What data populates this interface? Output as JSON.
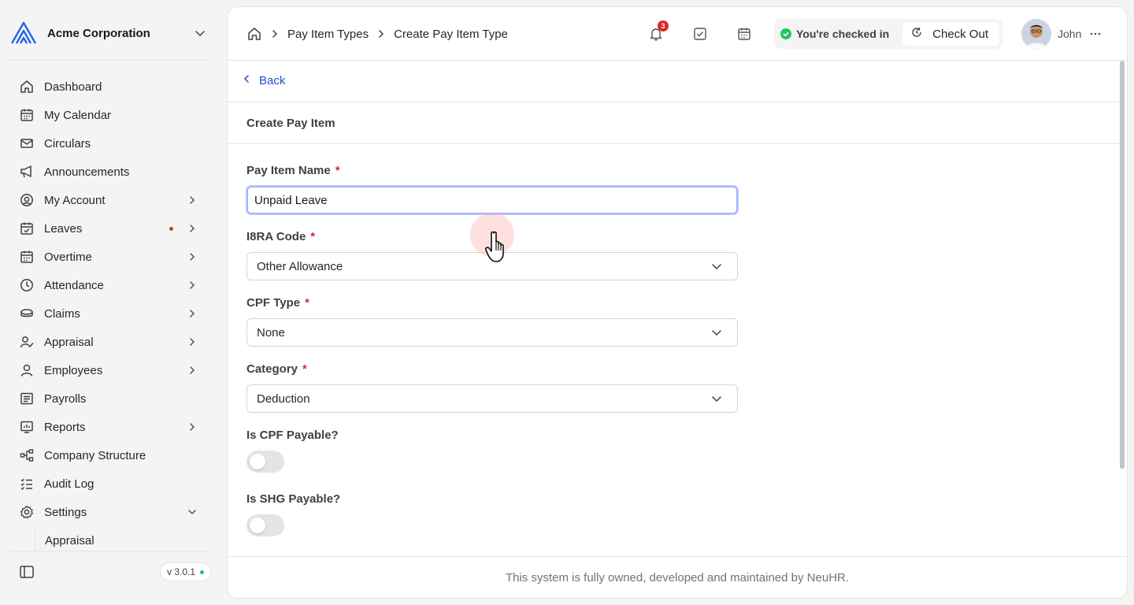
{
  "organization": {
    "name": "Acme Corporation"
  },
  "sidebar": {
    "items": [
      {
        "label": "Dashboard",
        "icon": "home-icon"
      },
      {
        "label": "My Calendar",
        "icon": "calendar-icon"
      },
      {
        "label": "Circulars",
        "icon": "mail-icon"
      },
      {
        "label": "Announcements",
        "icon": "megaphone-icon"
      },
      {
        "label": "My Account",
        "icon": "user-circle-icon"
      },
      {
        "label": "Leaves",
        "icon": "calendar-check-icon"
      },
      {
        "label": "Overtime",
        "icon": "calendar-clock-icon"
      },
      {
        "label": "Attendance",
        "icon": "clock-icon"
      },
      {
        "label": "Claims",
        "icon": "coins-icon"
      },
      {
        "label": "Appraisal",
        "icon": "user-check-icon"
      },
      {
        "label": "Employees",
        "icon": "user-icon"
      },
      {
        "label": "Payrolls",
        "icon": "receipt-icon"
      },
      {
        "label": "Reports",
        "icon": "chart-icon"
      },
      {
        "label": "Company Structure",
        "icon": "org-chart-icon"
      },
      {
        "label": "Audit Log",
        "icon": "list-check-icon"
      },
      {
        "label": "Settings",
        "icon": "gear-icon"
      }
    ],
    "sub_item_label": "Appraisal",
    "version": "v 3.0.1"
  },
  "breadcrumb": {
    "parent": "Pay Item Types",
    "current": "Create Pay Item Type"
  },
  "header": {
    "notification_count": "3",
    "status_text": "You're checked in",
    "checkout_label": "Check Out",
    "user_name": "John"
  },
  "page": {
    "back_label": "Back",
    "section_title": "Create Pay Item"
  },
  "form": {
    "pay_item_name": {
      "label": "Pay Item Name",
      "required_mark": "*",
      "value": "Unpaid Leave"
    },
    "ir8a_code": {
      "label": "I8RA Code",
      "required_mark": "*",
      "value": "Other Allowance"
    },
    "cpf_type": {
      "label": "CPF Type",
      "required_mark": "*",
      "value": "None"
    },
    "category": {
      "label": "Category",
      "required_mark": "*",
      "value": "Deduction"
    },
    "is_cpf_payable": {
      "label": "Is CPF Payable?",
      "checked": false
    },
    "is_shg_payable": {
      "label": "Is SHG Payable?",
      "checked": false
    }
  },
  "footer": {
    "text": "This system is fully owned, developed and maintained by NeuHR."
  },
  "colors": {
    "accent": "#1d4ed8",
    "badge": "#dc2626",
    "success": "#22c55e",
    "focus_ring": "#a5b4fc"
  }
}
